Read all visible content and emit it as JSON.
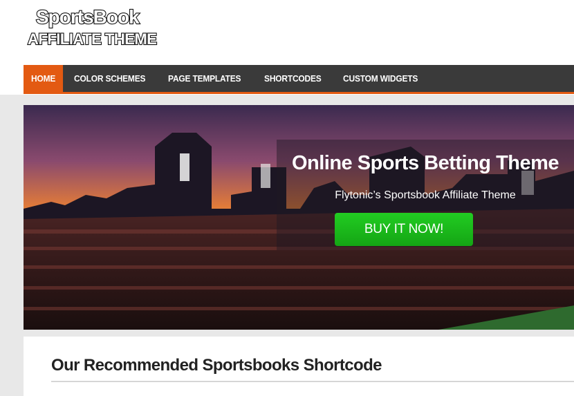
{
  "logo": {
    "line1": "SportsBook",
    "line2": "AFFILIATE THEME"
  },
  "nav": {
    "items": [
      {
        "label": "HOME",
        "active": true
      },
      {
        "label": "COLOR SCHEMES",
        "active": false
      },
      {
        "label": "PAGE TEMPLATES",
        "active": false
      },
      {
        "label": "SHORTCODES",
        "active": false
      },
      {
        "label": "CUSTOM WIDGETS",
        "active": false
      }
    ]
  },
  "hero": {
    "title": "Online Sports Betting Theme",
    "subtitle": "Flytonic’s Sportsbook Affiliate Theme",
    "cta": "BUY IT NOW!"
  },
  "section": {
    "title": "Our Recommended Sportsbooks Shortcode"
  },
  "colors": {
    "accent": "#e35a12",
    "nav_bg": "#3a3a3a",
    "cta": "#1fbf1f"
  }
}
